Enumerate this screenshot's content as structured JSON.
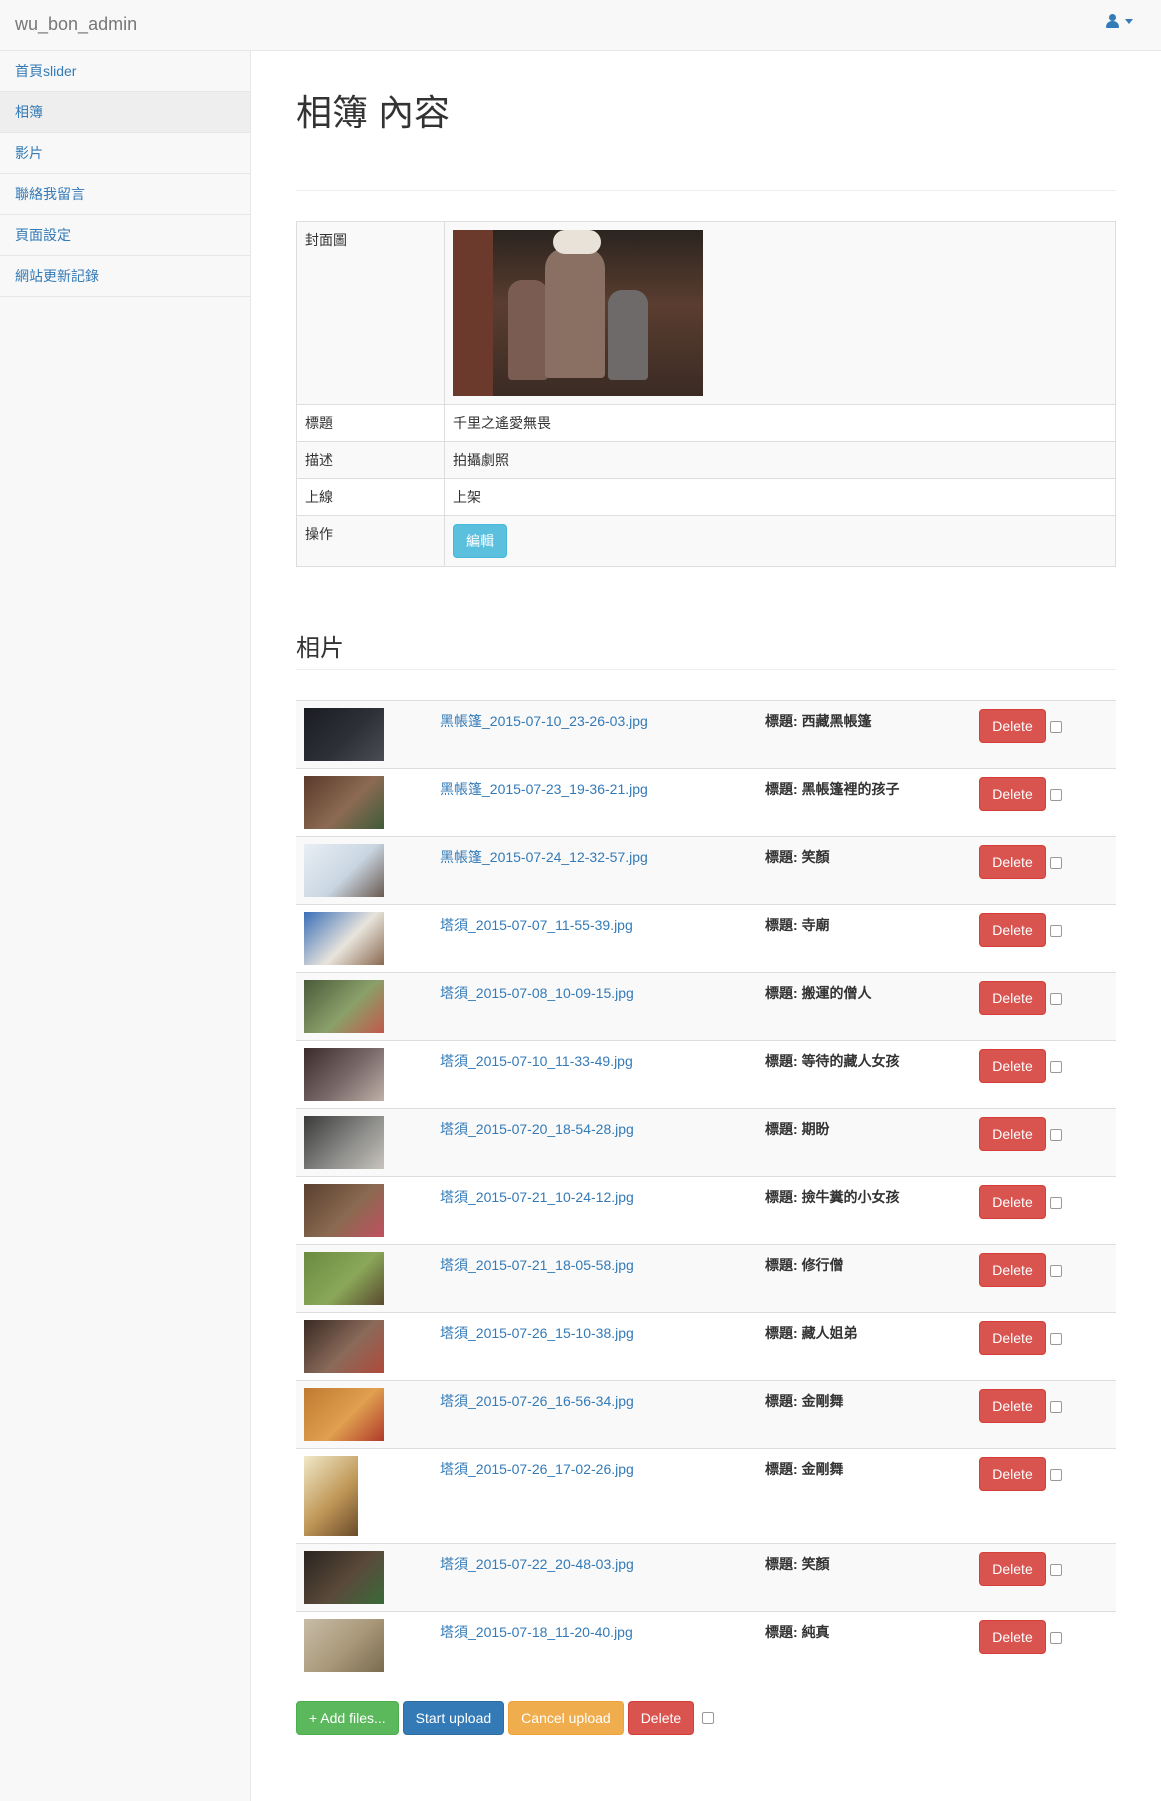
{
  "navbar": {
    "brand": "wu_bon_admin"
  },
  "sidebar": {
    "items": [
      {
        "label": "首頁slider"
      },
      {
        "label": "相簿"
      },
      {
        "label": "影片"
      },
      {
        "label": "聯絡我留言"
      },
      {
        "label": "頁面設定"
      },
      {
        "label": "網站更新記錄"
      }
    ],
    "active_index": 1
  },
  "page": {
    "title": "相簿 內容"
  },
  "album": {
    "cover_label": "封面圖",
    "title_label": "標題",
    "title_value": "千里之遙愛無畏",
    "desc_label": "描述",
    "desc_value": "拍攝劇照",
    "status_label": "上線",
    "status_value": "上架",
    "action_label": "操作",
    "edit_button": "編輯"
  },
  "photos_section": {
    "title": "相片",
    "title_prefix": "標題:",
    "delete_button": "Delete"
  },
  "photos": [
    {
      "file": "黑帳篷_2015-07-10_23-26-03.jpg",
      "title": "西藏黑帳篷",
      "colors": [
        "#1a1c22",
        "#2d3036",
        "#4a4d55"
      ]
    },
    {
      "file": "黑帳篷_2015-07-23_19-36-21.jpg",
      "title": "黑帳篷裡的孩子",
      "colors": [
        "#5a3a2c",
        "#8c6a52",
        "#3e5c3a"
      ]
    },
    {
      "file": "黑帳篷_2015-07-24_12-32-57.jpg",
      "title": "笑顏",
      "colors": [
        "#e8eef4",
        "#c9d6e2",
        "#6a5a50"
      ]
    },
    {
      "file": "塔須_2015-07-07_11-55-39.jpg",
      "title": "寺廟",
      "colors": [
        "#3a6fb8",
        "#e8e4dc",
        "#8a6a50"
      ]
    },
    {
      "file": "塔須_2015-07-08_10-09-15.jpg",
      "title": "搬運的僧人",
      "colors": [
        "#4a5a3a",
        "#8aa06a",
        "#c05a4a"
      ]
    },
    {
      "file": "塔須_2015-07-10_11-33-49.jpg",
      "title": "等待的藏人女孩",
      "colors": [
        "#3a2a2a",
        "#7a6a6a",
        "#c0b0a8"
      ]
    },
    {
      "file": "塔須_2015-07-20_18-54-28.jpg",
      "title": "期盼",
      "colors": [
        "#3a3a3a",
        "#8a8a88",
        "#c8c4bc"
      ]
    },
    {
      "file": "塔須_2015-07-21_10-24-12.jpg",
      "title": "撿牛糞的小女孩",
      "colors": [
        "#5a4030",
        "#8a6a50",
        "#c05060"
      ]
    },
    {
      "file": "塔須_2015-07-21_18-05-58.jpg",
      "title": "修行僧",
      "colors": [
        "#6a8a40",
        "#8aa858",
        "#5a4a30"
      ]
    },
    {
      "file": "塔須_2015-07-26_15-10-38.jpg",
      "title": "藏人姐弟",
      "colors": [
        "#3a2a24",
        "#8a6a5a",
        "#b04a3a"
      ]
    },
    {
      "file": "塔須_2015-07-26_16-56-34.jpg",
      "title": "金剛舞",
      "colors": [
        "#c07a30",
        "#e0a050",
        "#b03a2a"
      ]
    },
    {
      "file": "塔須_2015-07-26_17-02-26.jpg",
      "title": "金剛舞",
      "colors": [
        "#f0e8c8",
        "#c09858",
        "#6a4a2a"
      ],
      "tall": true
    },
    {
      "file": "塔須_2015-07-22_20-48-03.jpg",
      "title": "笑顏",
      "colors": [
        "#2a2420",
        "#5a4a3a",
        "#3a6a3a"
      ]
    },
    {
      "file": "塔須_2015-07-18_11-20-40.jpg",
      "title": "純真",
      "colors": [
        "#c8bca8",
        "#a89878",
        "#7a6a50"
      ]
    }
  ],
  "bottom_bar": {
    "add_files": "+ Add files...",
    "start_upload": "Start upload",
    "cancel_upload": "Cancel upload",
    "delete": "Delete"
  }
}
